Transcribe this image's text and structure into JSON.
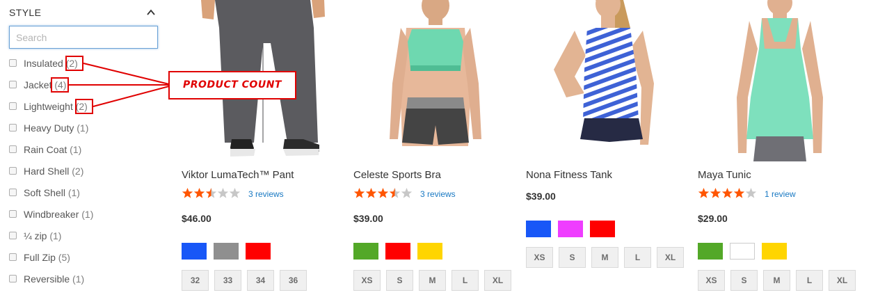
{
  "filter": {
    "title": "STYLE",
    "search_placeholder": "Search",
    "options": [
      {
        "label": "Insulated",
        "count": "(2)"
      },
      {
        "label": "Jacket",
        "count": "(4)"
      },
      {
        "label": "Lightweight",
        "count": "(2)"
      },
      {
        "label": "Heavy Duty",
        "count": "(1)"
      },
      {
        "label": "Rain Coat",
        "count": "(1)"
      },
      {
        "label": "Hard Shell",
        "count": "(2)"
      },
      {
        "label": "Soft Shell",
        "count": "(1)"
      },
      {
        "label": "Windbreaker",
        "count": "(1)"
      },
      {
        "label": "¼ zip",
        "count": "(1)"
      },
      {
        "label": "Full Zip",
        "count": "(5)"
      },
      {
        "label": "Reversible",
        "count": "(1)"
      }
    ]
  },
  "annotation": {
    "callout": "PRODUCT COUNT",
    "color": "#e00000"
  },
  "products": [
    {
      "name": "Viktor LumaTech™ Pant",
      "rating": 2.5,
      "reviews": "3 reviews",
      "price": "$46.00",
      "swatches": [
        {
          "color": "Blue",
          "hex": "#1857f7"
        },
        {
          "color": "Gray",
          "hex": "#8f8f8f"
        },
        {
          "color": "Red",
          "hex": "#ff0000"
        }
      ],
      "sizes": [
        "32",
        "33",
        "34",
        "36"
      ]
    },
    {
      "name": "Celeste Sports Bra",
      "rating": 3.5,
      "reviews": "3 reviews",
      "price": "$39.00",
      "swatches": [
        {
          "color": "Green",
          "hex": "#53a828"
        },
        {
          "color": "Red",
          "hex": "#ff0000"
        },
        {
          "color": "Yellow",
          "hex": "#ffd500"
        }
      ],
      "sizes": [
        "XS",
        "S",
        "M",
        "L",
        "XL"
      ]
    },
    {
      "name": "Nona Fitness Tank",
      "rating": null,
      "reviews": "",
      "price": "$39.00",
      "swatches": [
        {
          "color": "Blue",
          "hex": "#1857f7"
        },
        {
          "color": "Purple",
          "hex": "#ef3dff"
        },
        {
          "color": "Red",
          "hex": "#ff0000"
        }
      ],
      "sizes": [
        "XS",
        "S",
        "M",
        "L",
        "XL"
      ]
    },
    {
      "name": "Maya Tunic",
      "rating": 4,
      "reviews": "1 review",
      "price": "$29.00",
      "swatches": [
        {
          "color": "Green",
          "hex": "#53a828"
        },
        {
          "color": "White",
          "hex": "#ffffff"
        },
        {
          "color": "Yellow",
          "hex": "#ffd500"
        }
      ],
      "sizes": [
        "XS",
        "S",
        "M",
        "L",
        "XL"
      ]
    }
  ]
}
